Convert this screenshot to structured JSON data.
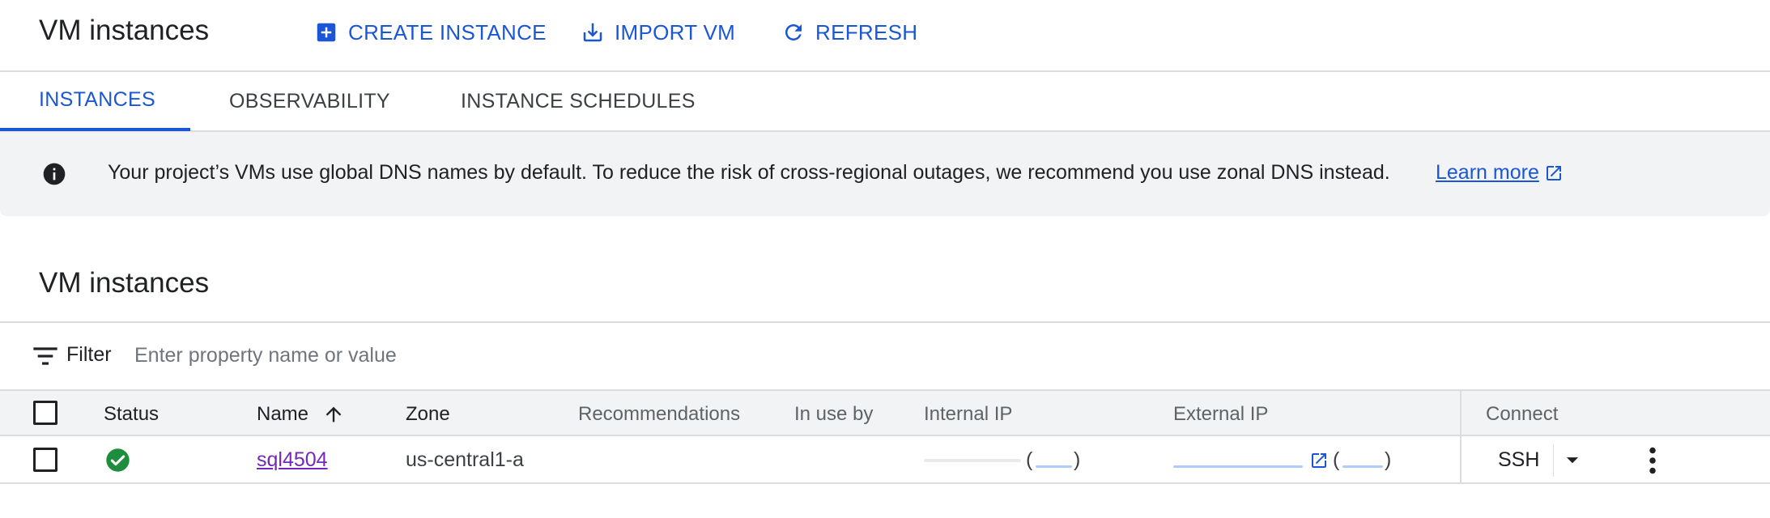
{
  "header": {
    "title": "VM instances",
    "create_label": "CREATE INSTANCE",
    "import_label": "IMPORT VM",
    "refresh_label": "REFRESH",
    "accent_color": "#1a56d6"
  },
  "tabs": [
    {
      "label": "INSTANCES",
      "active": true
    },
    {
      "label": "OBSERVABILITY",
      "active": false
    },
    {
      "label": "INSTANCE SCHEDULES",
      "active": false
    }
  ],
  "banner": {
    "icon": "info-icon",
    "text": "Your project’s VMs use global DNS names by default. To reduce the risk of cross-regional outages, we recommend you use zonal DNS instead.",
    "link_label": "Learn more",
    "link_icon": "open-in-new-icon"
  },
  "section": {
    "title": "VM instances"
  },
  "filter": {
    "icon": "filter-icon",
    "label": "Filter",
    "placeholder": "Enter property name or value"
  },
  "table": {
    "columns": [
      "Status",
      "Name",
      "Zone",
      "Recommendations",
      "In use by",
      "Internal IP",
      "External IP",
      "Connect"
    ],
    "sort": {
      "column": "Name",
      "direction": "ascending",
      "icon": "arrow-up-icon"
    },
    "rows": [
      {
        "status": "running",
        "status_icon": "check-circle-icon",
        "status_color": "#1e8e3e",
        "name": "sql4504",
        "zone": "us-central1-a",
        "recommendations": "",
        "in_use_by": "",
        "internal_ip": "redacted",
        "external_ip": "redacted",
        "connect_label": "SSH"
      }
    ]
  },
  "colors": {
    "link_visited": "#7627bb",
    "header_bg": "#f1f3f4",
    "divider": "#dadce0"
  }
}
